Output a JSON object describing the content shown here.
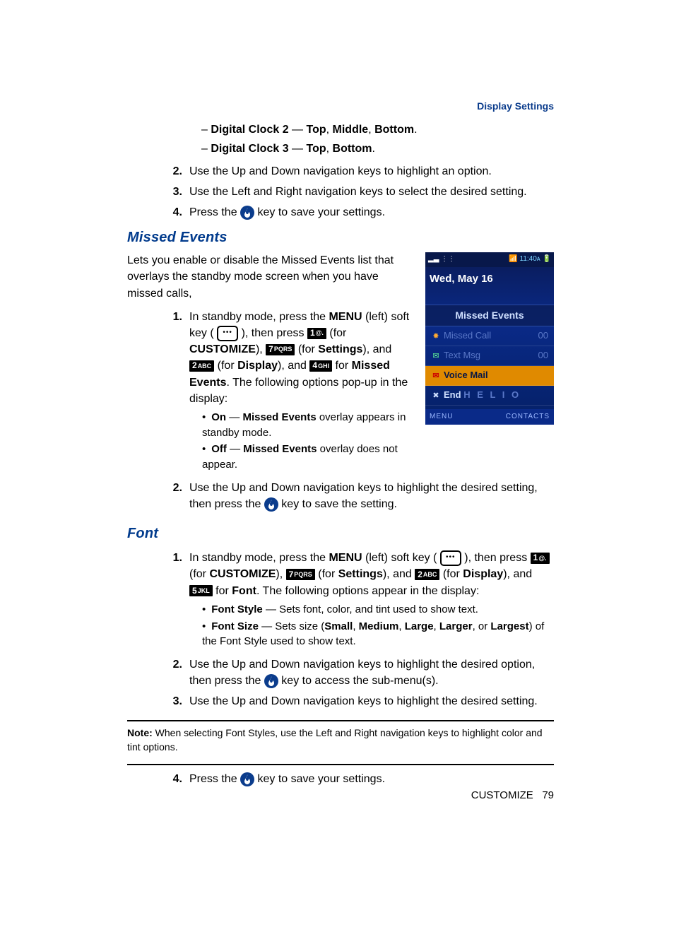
{
  "header": "Display Settings",
  "dashes": [
    {
      "label": "Digital Clock 2",
      "opts": [
        "Top",
        "Middle",
        "Bottom"
      ]
    },
    {
      "label": "Digital Clock 3",
      "opts": [
        "Top",
        "Bottom"
      ]
    }
  ],
  "topList": {
    "n2": "Use the Up and Down navigation keys to highlight an option.",
    "n3": "Use the Left and Right navigation keys to select the desired setting.",
    "n4_a": "Press the ",
    "n4_b": " key to save your settings."
  },
  "missed": {
    "title": "Missed Events",
    "intro": "Lets you enable or disable the Missed Events list that overlays the standby mode screen when you have missed calls,",
    "step1": {
      "a": "In standby mode, press the ",
      "menu": "MENU",
      "b": " (left) soft key ( ",
      "c": " ), then press ",
      "d": " (for ",
      "customize": "CUSTOMIZE",
      "e": "), ",
      "f": " (for ",
      "settings": "Settings",
      "g": "), and ",
      "h": " (for ",
      "display": "Display",
      "i": "), and ",
      "j": " for ",
      "missedEvents": "Missed Events",
      "k": ". The following options pop-up in the display:"
    },
    "bul": {
      "on_b": "On",
      "on_t1": " — ",
      "on_b2": "Missed Events",
      "on_t2": " overlay appears in standby mode.",
      "off_b": "Off",
      "off_t1": " — ",
      "off_b2": "Missed Events",
      "off_t2": " overlay does not appear."
    },
    "step2_a": "Use the Up and Down navigation keys to highlight the desired setting, then press the ",
    "step2_b": " key to save the setting."
  },
  "font": {
    "title": "Font",
    "step1": {
      "a": "In standby mode, press the ",
      "menu": "MENU",
      "b": " (left) soft key ( ",
      "c": " ), then press ",
      "d": " (for ",
      "customize": "CUSTOMIZE",
      "e": "), ",
      "f": " (for ",
      "settings": "Settings",
      "g": "), and ",
      "h": " (for ",
      "display": "Display",
      "i": "), and ",
      "j": " for ",
      "fontLabel": "Font",
      "k": ". The following options appear in the display:"
    },
    "bul": {
      "fs_b": "Font Style",
      "fs_t": " — Sets font, color, and tint used to show text.",
      "fz_b": "Font Size",
      "fz_t1": " — Sets size (",
      "fz_o1": "Small",
      "fz_c": ", ",
      "fz_o2": "Medium",
      "fz_o3": "Large",
      "fz_o4": "Larger",
      "fz_or": ", or ",
      "fz_o5": "Largest",
      "fz_t2": ") of the Font Style used to show text."
    },
    "step2_a": "Use the Up and Down navigation keys to highlight the desired option, then press the ",
    "step2_b": " key to access the sub-menu(s).",
    "step3": "Use the Up and Down navigation keys to highlight the desired setting.",
    "note_b": "Note:",
    "note_t": " When selecting Font Styles, use the Left and Right navigation keys to highlight color and tint options.",
    "step4_a": "Press the ",
    "step4_b": " key to save your settings."
  },
  "keys": {
    "k1": "1",
    "k1s": "@.",
    "k2": "2",
    "k2s": "ABC",
    "k4": "4",
    "k4s": "GHI",
    "k5": "5",
    "k5s": "JKL",
    "k7": "7",
    "k7s": "PQRS",
    "dots": "•••"
  },
  "phone": {
    "statusLeft": "▂▃ ⋮⋮",
    "statusRight": "📶 11:40ᴀ 🔋",
    "date": "Wed, May 16",
    "panel": "Missed Events",
    "rows": [
      {
        "icon": "✸",
        "label": "Missed Call",
        "count": "00"
      },
      {
        "icon": "✉",
        "label": "Text Msg",
        "count": "00"
      },
      {
        "icon": "✉",
        "label": "Voice Mail",
        "count": ""
      },
      {
        "icon": "✖",
        "label": "End",
        "count": ""
      }
    ],
    "skLeft": "MENU",
    "skRight": "CONTACTS"
  },
  "footer": {
    "section": "CUSTOMIZE",
    "page": "79"
  }
}
